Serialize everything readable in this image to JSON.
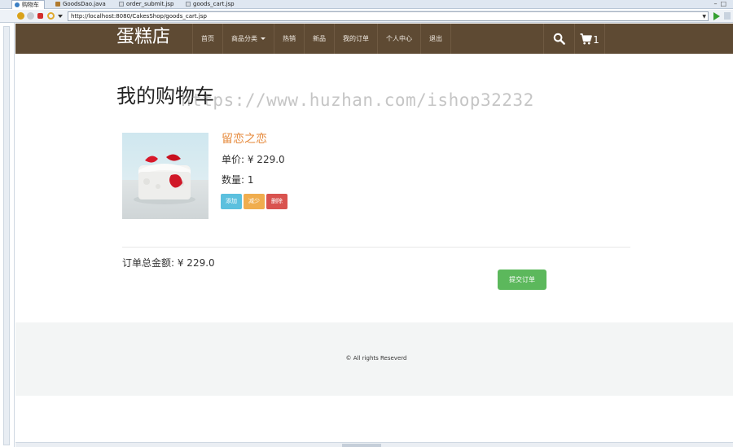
{
  "ide_tabs": [
    {
      "label": "购物车",
      "icon": "globe-icon",
      "active": true
    },
    {
      "label": "GoodsDao.java",
      "icon": "java-file-icon",
      "active": false
    },
    {
      "label": "order_submit.jsp",
      "icon": "jsp-file-icon",
      "active": false
    },
    {
      "label": "goods_cart.jsp",
      "icon": "jsp-file-icon",
      "active": false
    }
  ],
  "browser": {
    "url": "http://localhost:8080/CakesShop/goods_cart.jsp"
  },
  "navbar": {
    "brand": "蛋糕店",
    "items": [
      "首页",
      "商品分类",
      "热销",
      "新品",
      "我的订单",
      "个人中心",
      "退出"
    ],
    "cart_count": "1",
    "bg_color": "#5e4a33"
  },
  "page": {
    "title": "我的购物车",
    "watermark": "https://www.huzhan.com/ishop32232"
  },
  "cart": {
    "items": [
      {
        "name": "留恋之恋",
        "price_label": "单价: ¥ 229.0",
        "qty_label": "数量: 1",
        "buttons": {
          "add": "添加",
          "minus": "减少",
          "delete": "删除"
        }
      }
    ],
    "total_label": "订单总金额: ¥ 229.0",
    "submit_label": "提交订单"
  },
  "footer": {
    "text": "© All rights Reseverd"
  },
  "colors": {
    "accent_name": "#e68a3c",
    "btn_add": "#5bc0de",
    "btn_minus": "#f0ad4e",
    "btn_delete": "#d9534f",
    "btn_submit": "#5cb85c"
  }
}
